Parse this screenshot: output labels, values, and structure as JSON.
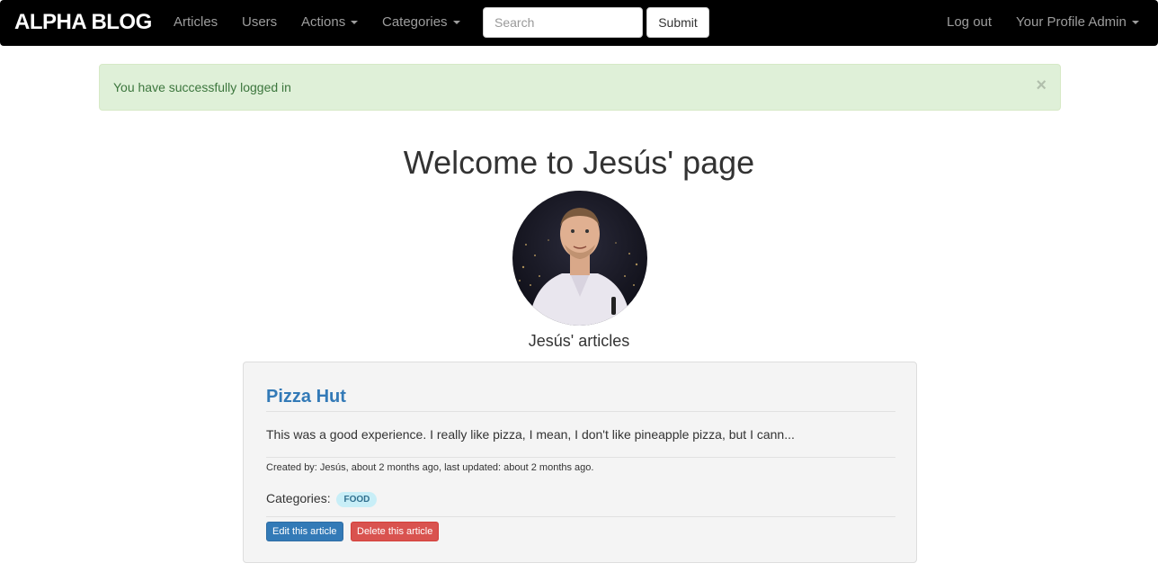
{
  "navbar": {
    "brand": "ALPHA BLOG",
    "links": {
      "articles": "Articles",
      "users": "Users",
      "actions": "Actions",
      "categories": "Categories"
    },
    "search": {
      "placeholder": "Search",
      "value": ""
    },
    "submit_label": "Submit",
    "logout": "Log out",
    "profile": "Your Profile Admin"
  },
  "alert": {
    "message": "You have successfully logged in",
    "close_symbol": "×"
  },
  "page": {
    "title": "Welcome to Jesús' page",
    "avatar_icon": "user-photo",
    "articles_heading": "Jesús' articles"
  },
  "article": {
    "title": "Pizza Hut",
    "description": "This was a good experience. I really like pizza, I mean, I don't like pineapple pizza, but I cann...",
    "meta": "Created by: Jesús, about 2 months ago, last updated: about 2 months ago.",
    "categories_label": "Categories:",
    "categories": [
      "FOOD"
    ],
    "edit_label": "Edit this article",
    "delete_label": "Delete this article"
  },
  "colors": {
    "navbar_bg": "#000000",
    "link": "#337ab7",
    "alert_bg": "#dff0d8",
    "danger": "#d9534f"
  }
}
